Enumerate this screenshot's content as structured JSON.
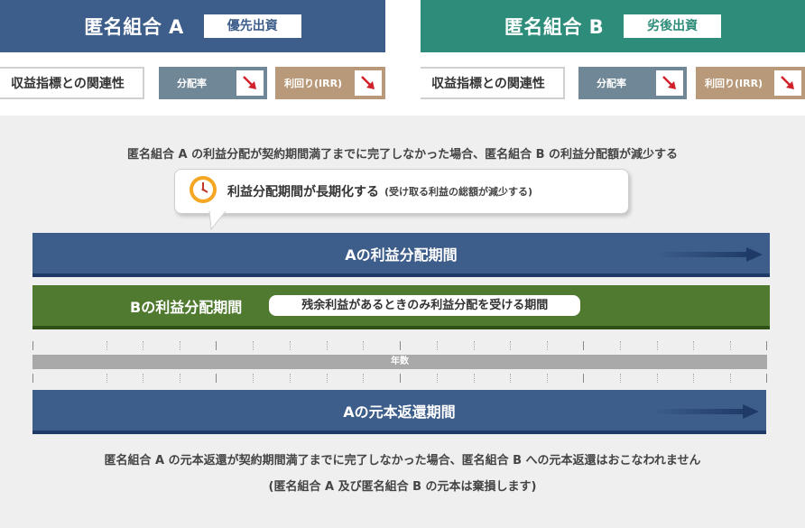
{
  "header_a": {
    "title": "匿名組合 A",
    "badge": "優先出資"
  },
  "header_b": {
    "title": "匿名組合 B",
    "badge": "劣後出資"
  },
  "indicators_a": {
    "label": "収益指標との関連性",
    "chips": [
      {
        "label": "分配率",
        "color": "#6f8797"
      },
      {
        "label": "利回り(IRR)",
        "color": "#b89a7a"
      }
    ]
  },
  "indicators_b": {
    "label": "収益指標との関連性",
    "chips": [
      {
        "label": "分配率",
        "color": "#6f8797"
      },
      {
        "label": "利回り(IRR)",
        "color": "#b89a7a"
      }
    ]
  },
  "note_top": "匿名組合 A の利益分配が契約期間満了までに完了しなかった場合、匿名組合 B の利益分配額が減少する",
  "bubble": {
    "main": "利益分配期間が長期化する",
    "sub": "(受け取る利益の総額が減少する)",
    "icon": "clock-icon"
  },
  "bar_a": "Aの利益分配期間",
  "bar_b": {
    "label": "Bの利益分配期間",
    "pill": "残余利益があるときのみ利益分配を受ける期間"
  },
  "axis_label": "年数",
  "bar_c": "Aの元本返還期間",
  "note_bottom_1": "匿名組合 A の元本返還が契約期間満了までに完了しなかった場合、匿名組合 B への元本返還はおこなわれません",
  "note_bottom_2": "(匿名組合 A 及び匿名組合 B の元本は棄損します)",
  "colors": {
    "blue": "#3d5d8a",
    "green_teal": "#2e8c7a",
    "green_bar": "#4f7a30",
    "down_arrow": "#d0212a"
  }
}
